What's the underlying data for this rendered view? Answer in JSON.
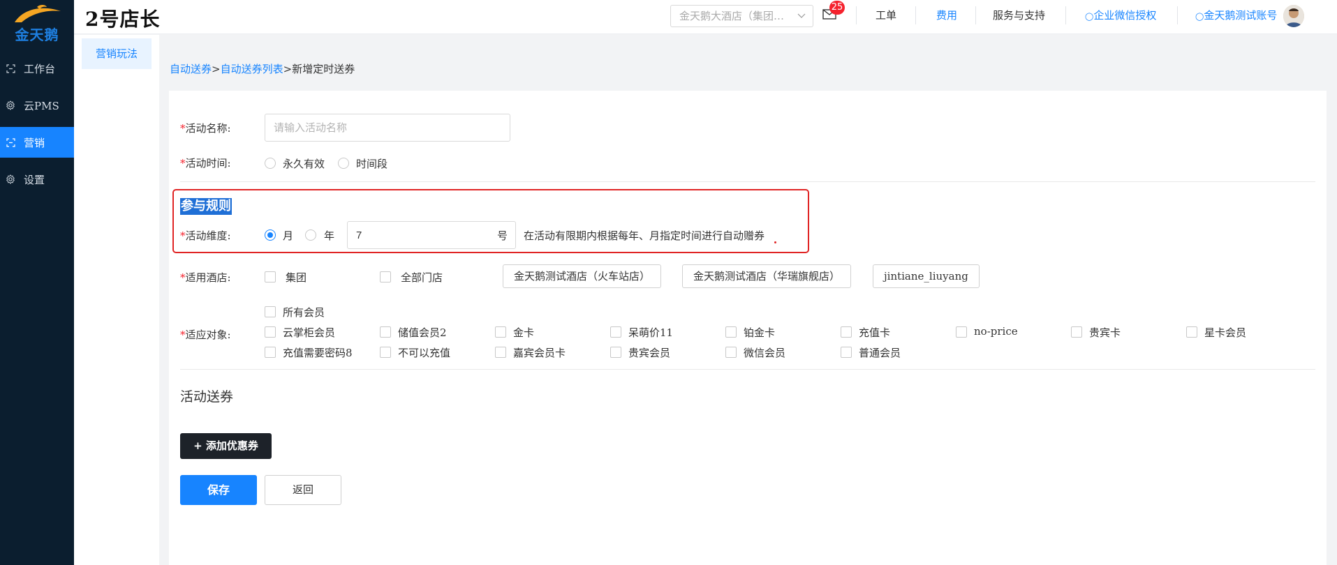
{
  "app": {
    "logo_text": "金天鹅",
    "brand_title": "2号店长"
  },
  "leftnav": {
    "items": [
      {
        "label": "工作台",
        "icon": "workbench-icon",
        "active": false
      },
      {
        "label": "云PMS",
        "icon": "gear-icon",
        "active": false
      },
      {
        "label": "营销",
        "icon": "marketing-icon",
        "active": true
      },
      {
        "label": "设置",
        "icon": "gear-icon",
        "active": false
      }
    ]
  },
  "topbar": {
    "hotel_select_value": "金天鹅大酒店（集团…",
    "mail_badge": "25",
    "links": {
      "ticket": "工单",
      "fees": "费用",
      "service": "服务与支持",
      "wecom": "企业微信授权",
      "account": "金天鹅测试账号"
    }
  },
  "submenu": {
    "item": "营销玩法"
  },
  "breadcrumb": {
    "auto_coupon": "自动送券",
    "sep": ">",
    "coupon_list": "自动送券列表",
    "current": "新增定时送券"
  },
  "form": {
    "name_label": "活动名称:",
    "name_placeholder": "请输入活动名称",
    "time_label": "活动时间:",
    "time_options": [
      "永久有效",
      "时间段"
    ],
    "rules_title": "参与规则",
    "dimension_label": "活动维度:",
    "dimension_options": [
      "月",
      "年"
    ],
    "dimension_value": "7",
    "dimension_suffix": "号",
    "dimension_hint": "在活动有限期内根据每年、月指定时间进行自动赠券",
    "hotel_label": "适用酒店:",
    "hotel_checks": [
      "集团",
      "全部门店"
    ],
    "hotel_tags": [
      "金天鹅测试酒店（火车站店）",
      "金天鹅测试酒店（华瑞旗舰店）",
      "jintiane_liuyang"
    ],
    "target_label": "适应对象:",
    "all_members": "所有会员",
    "member_row1": [
      "云掌柜会员",
      "储值会员2",
      "金卡",
      "呆萌价11",
      "铂金卡",
      "充值卡",
      "no-price",
      "贵宾卡",
      "星卡会员"
    ],
    "member_row2": [
      "充值需要密码8",
      "不可以充值",
      "嘉宾会员卡",
      "贵宾会员",
      "微信会员",
      "普通会员"
    ],
    "coupon_section": "活动送券",
    "add_coupon": "+ 添加优惠券",
    "save": "保存",
    "back": "返回"
  }
}
